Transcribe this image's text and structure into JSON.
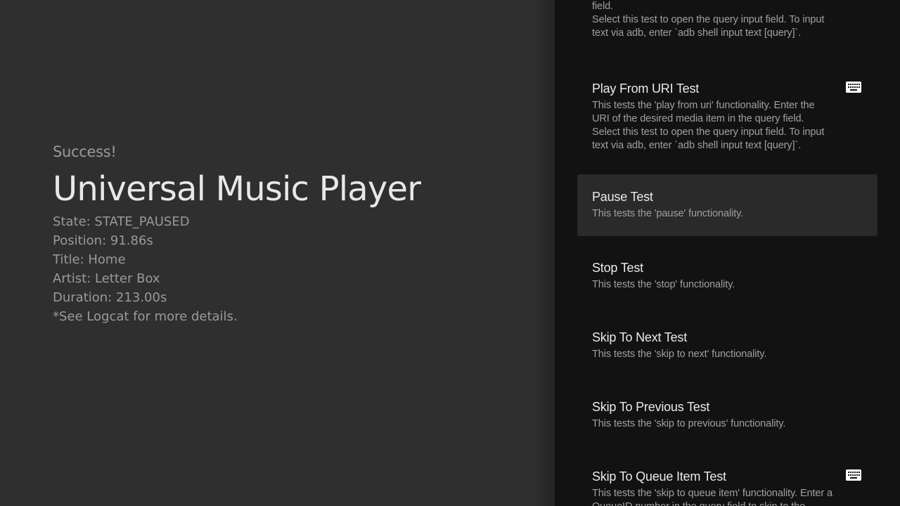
{
  "status": {
    "heading": "Success!",
    "app_title": "Universal Music Player",
    "lines": [
      "State: STATE_PAUSED",
      "Position: 91.86s",
      "Title: Home",
      "Artist: Letter Box",
      "Duration: 213.00s",
      "*See Logcat for more details."
    ]
  },
  "tests": [
    {
      "name": "",
      "desc": "the media ID of the desired media item in the query field.\nSelect this test to open the query input field. To input text via adb, enter `adb shell input text [query]`.",
      "icon": "keyboard-icon"
    },
    {
      "name": "Play From URI Test",
      "desc": "This tests the 'play from uri' functionality. Enter the URI of the desired media item in the query field.\nSelect this test to open the query input field. To input text via adb, enter `adb shell input text [query]`.",
      "icon": "keyboard-icon"
    },
    {
      "name": "Pause Test",
      "desc": "This tests the 'pause' functionality.",
      "icon": ""
    },
    {
      "name": "Stop Test",
      "desc": "This tests the 'stop' functionality.",
      "icon": ""
    },
    {
      "name": "Skip To Next Test",
      "desc": "This tests the 'skip to next' functionality.",
      "icon": ""
    },
    {
      "name": "Skip To Previous Test",
      "desc": "This tests the 'skip to previous' functionality.",
      "icon": ""
    },
    {
      "name": "Skip To Queue Item Test",
      "desc": "This tests the 'skip to queue item' functionality. Enter a QueueID number in the query field to skip to the",
      "icon": "keyboard-icon"
    }
  ],
  "colors": {
    "left_bg": "#2f2f2f",
    "right_bg": "#121212",
    "focused_bg": "#2a2a2a",
    "title_text": "#e8e8e8",
    "secondary_text": "#9a9a9a"
  }
}
